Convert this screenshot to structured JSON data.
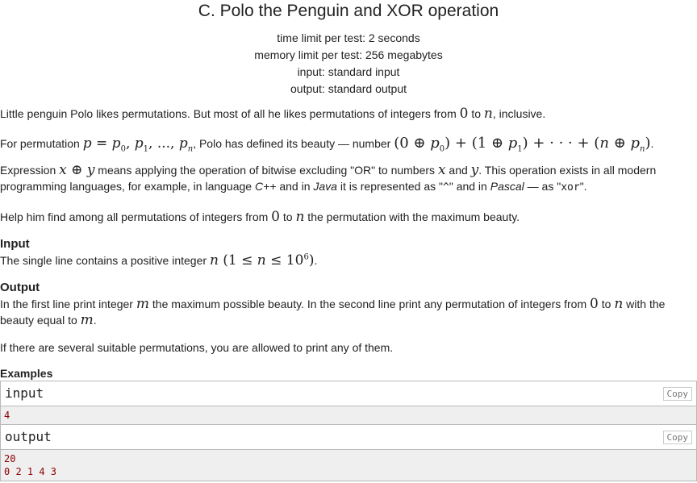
{
  "problem": {
    "title": "C. Polo the Penguin and XOR operation",
    "time_limit": "time limit per test: 2 seconds",
    "memory_limit": "memory limit per test: 256 megabytes",
    "input_file": "input: standard input",
    "output_file": "output: standard output"
  },
  "statement": {
    "p1_a": "Little penguin Polo likes permutations. But most of all he likes permutations of integers from ",
    "p1_zero": "0",
    "p1_b": " to ",
    "p1_n": "n",
    "p1_c": ", inclusive.",
    "p2_a": "For permutation ",
    "p2_b": ", Polo has defined its beauty — number ",
    "p2_c": ".",
    "p3_a": "Expression ",
    "p3_b": " means applying the operation of bitwise excluding \"OR\" to numbers ",
    "p3_x": "x",
    "p3_c": " and ",
    "p3_y": "y",
    "p3_d": ". This operation exists in all modern programming languages, for example, in language ",
    "p3_cpp": "C++",
    "p3_e": " and in ",
    "p3_java": "Java",
    "p3_f": " it is represented as \"",
    "p3_caret": "^",
    "p3_g": "\" and in ",
    "p3_pascal": "Pascal",
    "p3_h": " — as \"",
    "p3_xor": "xor",
    "p3_i": "\".",
    "p4_a": "Help him find among all permutations of integers from ",
    "p4_zero": "0",
    "p4_b": " to ",
    "p4_n": "n",
    "p4_c": " the permutation with the maximum beauty."
  },
  "input_section": {
    "title": "Input",
    "text_a": "The single line contains a positive integer ",
    "text_b": "."
  },
  "output_section": {
    "title": "Output",
    "p1_a": "In the first line print integer ",
    "p1_m": "m",
    "p1_b": " the maximum possible beauty. In the second line print any permutation of integers from ",
    "p1_zero": "0",
    "p1_c": " to ",
    "p1_n": "n",
    "p1_d": " with the beauty equal to ",
    "p1_m2": "m",
    "p1_e": ".",
    "p2": "If there are several suitable permutations, you are allowed to print any of them."
  },
  "examples": {
    "title": "Examples",
    "input_label": "input",
    "output_label": "output",
    "copy_label": "Copy",
    "input_text": "4",
    "output_text": "20\n0 2 1 4 3"
  }
}
